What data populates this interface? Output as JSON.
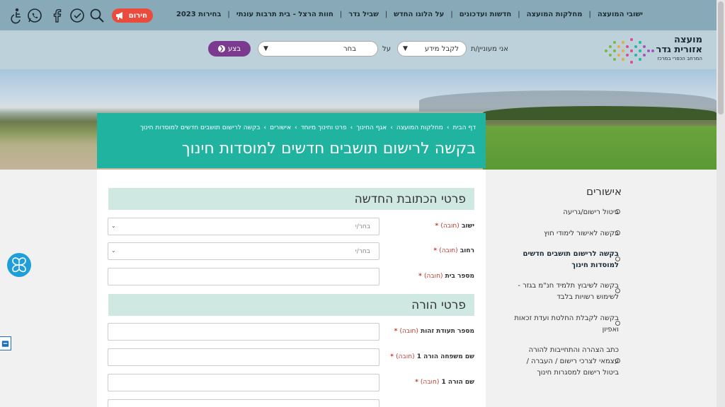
{
  "topnav": {
    "items": [
      "ישובי המועצה",
      "מחלקות המועצה",
      "חדשות ועדכונים",
      "על הלוגו החדש",
      "שביל גדר",
      "חוות הרצל - בית תרבות עונתי",
      "בחירות 2023"
    ],
    "separator": "|",
    "emergency_label": "חירום"
  },
  "icons": [
    "accessibility-icon",
    "whatsapp-icon",
    "facebook-icon",
    "service-clock-icon",
    "search-icon"
  ],
  "logo": {
    "line1": "מועצה",
    "line2": "אזורית גדר",
    "line3": "המרחב הכפרי במרכז"
  },
  "search": {
    "interested_label": "אני מעוניין/ת",
    "info_select": "לקבל מידע",
    "on_label": "על",
    "choose_select": "בחר",
    "go_button": "בצע"
  },
  "breadcrumb": [
    "דף הבית",
    "מחלקות המועצה",
    "אגף החינוך",
    "פרט וחינוך מיוחד",
    "אישורים",
    "בקשה לרישום תושבים חדשים למוסדות חינוך"
  ],
  "page_title": "בקשה לרישום תושבים חדשים למוסדות חינוך",
  "form": {
    "section_address": "פרטי הכתובת החדשה",
    "section_parent": "פרטי הורה",
    "required_text": "(חובה)",
    "star": "*",
    "placeholder_choose": "בחר/י",
    "fields": {
      "settlement": "ישוב",
      "street": "רחוב",
      "house_number": "מספר בית",
      "id_number": "מספר תעודת זהות",
      "parent1_lastname": "שם משפחה הורה 1",
      "parent1_firstname": "שם הורה 1"
    }
  },
  "sidebar": {
    "title": "אישורים",
    "items": [
      "ביטול רישום/גריעה",
      "בקשה לאישור לימודי חוץ",
      "בקשה לרישום תושבים חדשים למוסדות חינוך",
      "בקשה לשיבוץ תלמיד חנ\"מ בגזר - לשימוש רשויות בלבד",
      "בקשה לקבלת החלטת ועדת זכאות ואפיון",
      "כתב הצהרה והתחייבות להורה עצמאי לצרכי רישום / העברה / ביטול רישום למסגרות חינוך"
    ]
  },
  "colors": {
    "topbar": "#88a9b8",
    "searchrow": "#bcd1da",
    "title_card": "#1fb3a0",
    "section_head": "#cfe8e2",
    "go_button": "#7a3b8f",
    "emergency": "#ea4b3c"
  }
}
